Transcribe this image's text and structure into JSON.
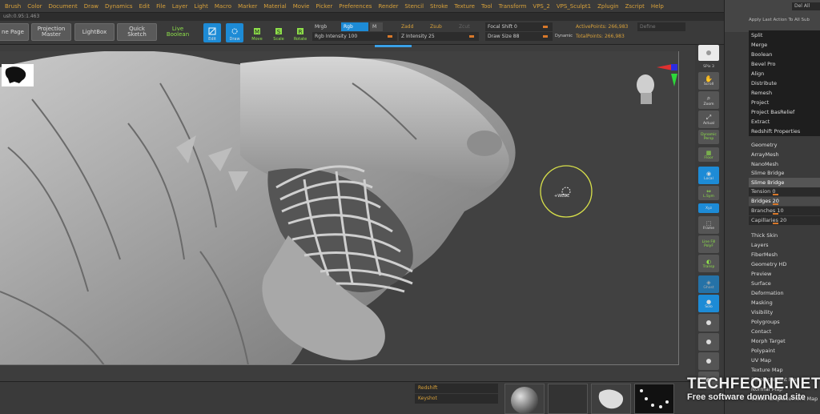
{
  "menu": [
    "Brush",
    "Color",
    "Document",
    "Draw",
    "Dynamics",
    "Edit",
    "File",
    "Layer",
    "Light",
    "Macro",
    "Marker",
    "Material",
    "Movie",
    "Picker",
    "Preferences",
    "Render",
    "Stencil",
    "Stroke",
    "Texture",
    "Tool",
    "Transform",
    "VPS_2",
    "VPS_Sculpt1",
    "Zplugin",
    "Zscript",
    "Help"
  ],
  "subbar_text": "ush:0.95:1.463",
  "toolbar": {
    "home_page": "ne Page",
    "projection_master_1": "Projection",
    "projection_master_2": "Master",
    "lightbox": "LightBox",
    "quick_sketch_1": "Quick",
    "quick_sketch_2": "Sketch",
    "live_boolean": "Live Boolean",
    "edit": "Edit",
    "draw": "Draw",
    "move": "Move",
    "scale": "Scale",
    "rotate": "Rotate",
    "mrgb": "Mrgb",
    "rgb": "Rgb",
    "m": "M",
    "rgb_intensity": "Rgb Intensity 100",
    "zadd": "Zadd",
    "zsub": "Zsub",
    "zcut": "Zcut",
    "z_intensity": "Z Intensity 25",
    "focal_shift": "Focal Shift 0",
    "draw_size": "Draw Size 88",
    "dynamic": "Dynamic",
    "active_points": "ActivePoints: 266,983",
    "total_points": "TotalPoints: 266,983",
    "define": "Define"
  },
  "canvas": {
    "brush_label": "+WEDL"
  },
  "shelf": {
    "bpr": "BPR",
    "spix": "SPix 3",
    "scroll": "Scroll",
    "zoom": "Zoom",
    "actual": "Actual",
    "aahalf": "AAHalf",
    "dynamic": "Dynamic",
    "persp": "Persp",
    "floor": "Floor",
    "local": "Local",
    "lsym": "L.Sym",
    "xyz": "Xyz",
    "frame": "Frame",
    "line_fill": "Line Fill",
    "polyf": "PolyF",
    "transp": "Transp",
    "ghost": "Ghost",
    "solo": "Solo"
  },
  "panel": {
    "del_all": "Del All",
    "apply_last": "Apply Last Action To All Sub",
    "actions": [
      "Split",
      "Merge",
      "Boolean",
      "Bevel Pro",
      "Align",
      "Distribute",
      "Remesh",
      "Project",
      "Project BasRelief",
      "Extract",
      "Redshift Properties"
    ],
    "groups_a": [
      "Geometry",
      "ArrayMesh",
      "NanoMesh"
    ],
    "slime_header": "Slime Bridge",
    "slime_selected": "Slime Bridge",
    "slime_sliders": [
      "Tension 0",
      "Bridges 20",
      "Branches 10",
      "Capillaries 20"
    ],
    "groups_b": [
      "Thick Skin",
      "Layers",
      "FiberMesh",
      "Geometry HD",
      "Preview",
      "Surface",
      "Deformation",
      "Masking",
      "Visibility",
      "Polygroups",
      "Contact",
      "Morph Target",
      "Polypaint",
      "UV Map",
      "Texture Map",
      "Displacement Map",
      "Normal Map",
      "Vector Displacement Map"
    ]
  },
  "bottom": {
    "redshift": "Redshift",
    "keyshot": "Keyshot"
  },
  "watermark": {
    "line1": "TECHFEONE.NET",
    "line2": "Free software download site"
  },
  "colors": {
    "accent_blue": "#1d8bd6",
    "menu_orange": "#d8a13a",
    "slider_orange": "#d8782a"
  }
}
